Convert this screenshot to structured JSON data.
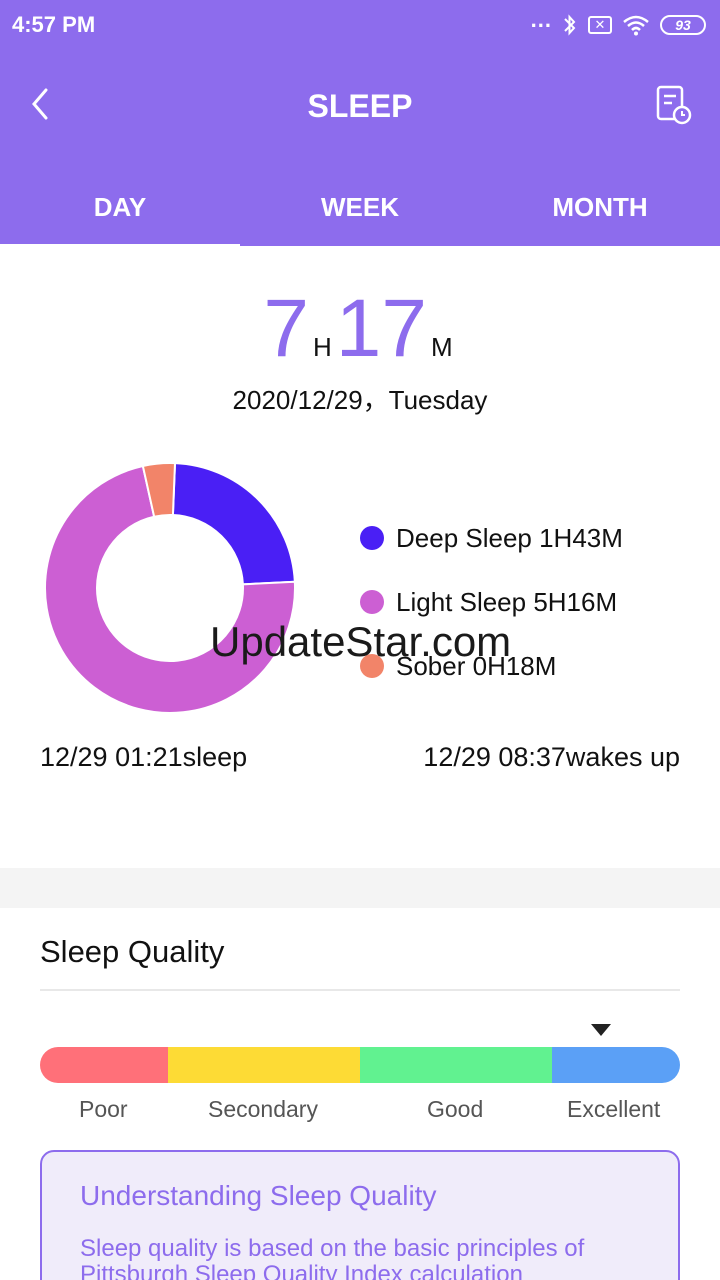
{
  "status_bar": {
    "time": "4:57 PM",
    "dots": "...",
    "battery": "93"
  },
  "header": {
    "title": "SLEEP"
  },
  "tabs": [
    {
      "label": "DAY",
      "active": true
    },
    {
      "label": "WEEK",
      "active": false
    },
    {
      "label": "MONTH",
      "active": false
    }
  ],
  "summary": {
    "hours": "7",
    "hours_unit": "H",
    "minutes": "17",
    "minutes_unit": "M",
    "date": "2020/12/29，Tuesday"
  },
  "breakdown": [
    {
      "label": "Deep Sleep 1H43M",
      "minutes": 103,
      "color": "#4a1ff5"
    },
    {
      "label": "Light Sleep 5H16M",
      "minutes": 316,
      "color": "#cc5fd3"
    },
    {
      "label": "Sober 0H18M",
      "minutes": 18,
      "color": "#f28469"
    }
  ],
  "watermark": "UpdateStar.com",
  "times": {
    "sleep": "12/29 01:21sleep",
    "wake": "12/29 08:37wakes up"
  },
  "quality": {
    "title": "Sleep Quality",
    "current": "Excellent",
    "levels": [
      {
        "label": "Poor",
        "color": "#ff7079",
        "share": 0.2
      },
      {
        "label": "Secondary",
        "color": "#fddb35",
        "share": 0.3
      },
      {
        "label": "Good",
        "color": "#61f290",
        "share": 0.3
      },
      {
        "label": "Excellent",
        "color": "#5ba0f6",
        "share": 0.2
      }
    ]
  },
  "info": {
    "title": "Understanding Sleep Quality",
    "body": "Sleep quality is based on the basic principles of Pittsburgh Sleep Quality Index calculation"
  },
  "colors": {
    "accent": "#8d6ced"
  }
}
